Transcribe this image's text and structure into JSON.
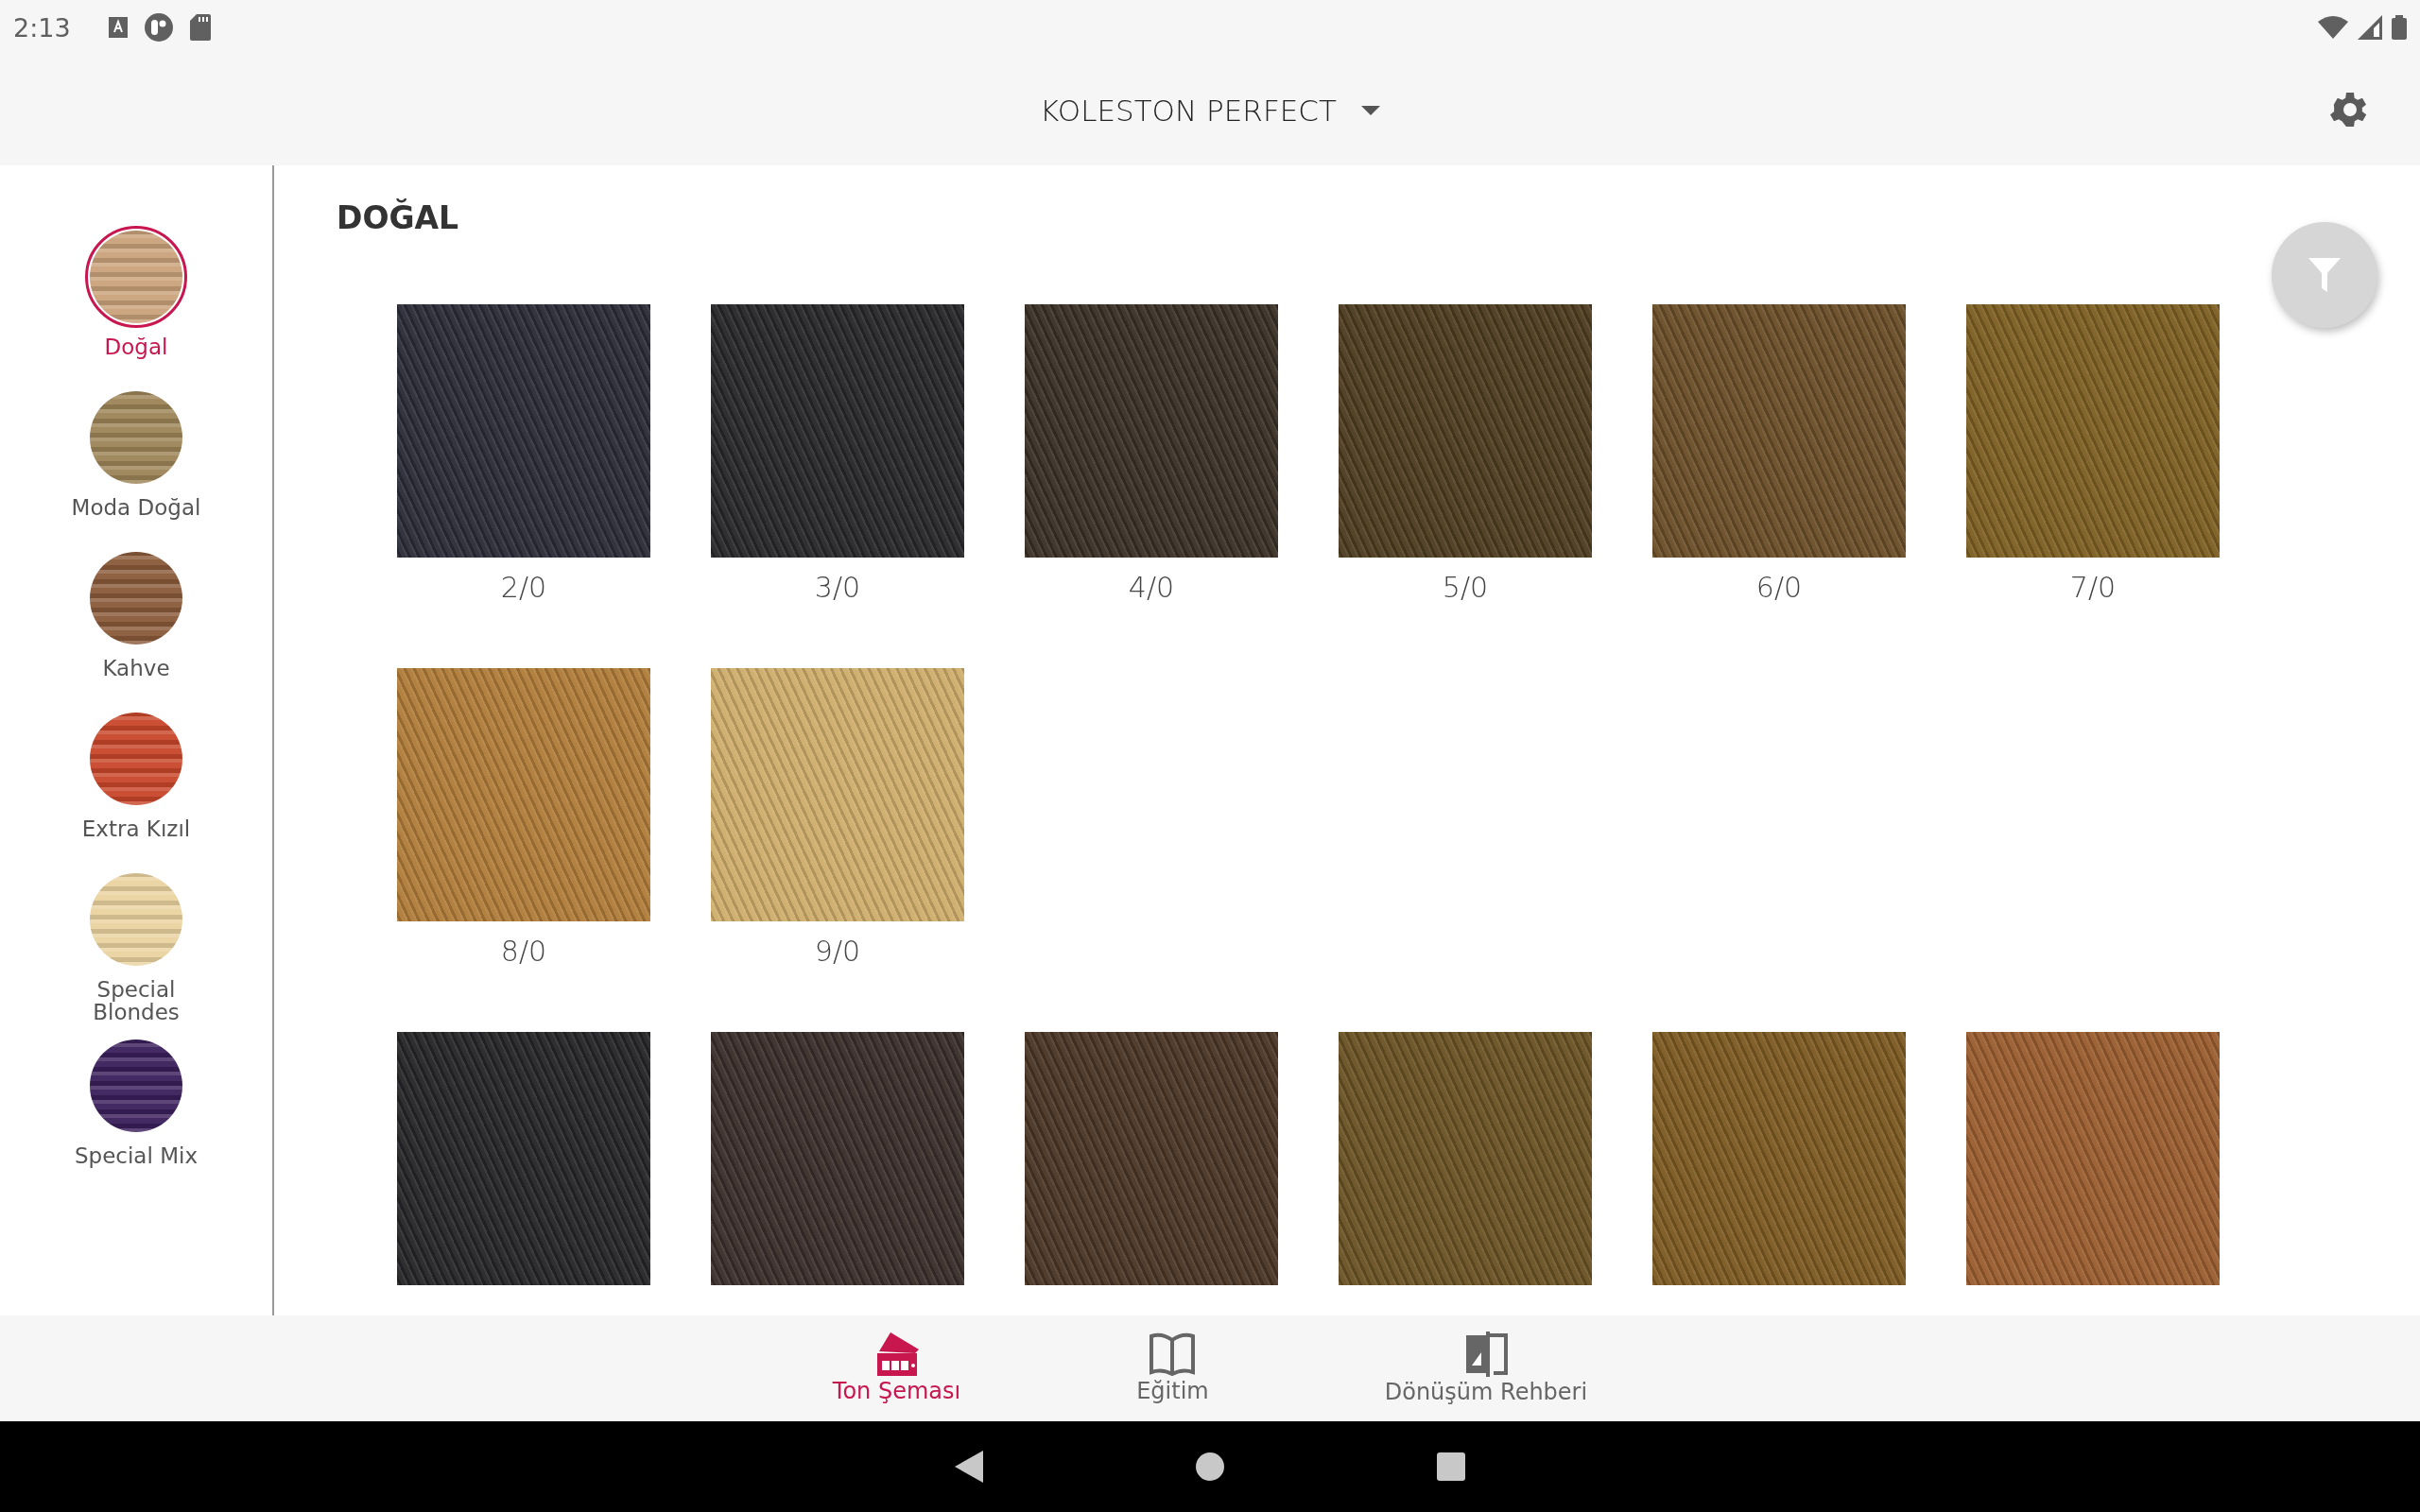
{
  "status_bar": {
    "time": "2:13"
  },
  "header": {
    "title": "KOLESTON PERFECT"
  },
  "sidebar": {
    "items": [
      {
        "label": "Doğal",
        "selected": true,
        "color": "#c9a27a"
      },
      {
        "label": "Moda Doğal",
        "selected": false,
        "color": "#9c8457"
      },
      {
        "label": "Kahve",
        "selected": false,
        "color": "#8a5a3a"
      },
      {
        "label": "Extra Kızıl",
        "selected": false,
        "color": "#c8462a"
      },
      {
        "label": "Special Blondes",
        "selected": false,
        "color": "#ead3a0"
      },
      {
        "label": "Special Mix",
        "selected": false,
        "color": "#3a1f5a"
      }
    ]
  },
  "content": {
    "sections": [
      {
        "title": "DOĞAL",
        "swatches": [
          {
            "label": "2/0",
            "color": "#2c2c38"
          },
          {
            "label": "3/0",
            "color": "#28282a"
          },
          {
            "label": "4/0",
            "color": "#3a3026"
          },
          {
            "label": "5/0",
            "color": "#4d3c20"
          },
          {
            "label": "6/0",
            "color": "#6a4e28"
          },
          {
            "label": "7/0",
            "color": "#7d5f22"
          },
          {
            "label": "8/0",
            "color": "#b07d3a"
          },
          {
            "label": "9/0",
            "color": "#cfae6c"
          }
        ]
      },
      {
        "swatches": [
          {
            "color": "#262628"
          },
          {
            "color": "#3a2e2a"
          },
          {
            "color": "#4a3626"
          },
          {
            "color": "#6a5224"
          },
          {
            "color": "#7d5a22"
          },
          {
            "color": "#9a5e30"
          }
        ]
      }
    ]
  },
  "bottom_nav": {
    "tabs": [
      {
        "label": "Ton Şeması",
        "selected": true,
        "kind": "swatch"
      },
      {
        "label": "Eğitim",
        "selected": false,
        "kind": "book"
      },
      {
        "label": "Dönüşüm Rehberi",
        "selected": false,
        "kind": "convert"
      }
    ]
  }
}
